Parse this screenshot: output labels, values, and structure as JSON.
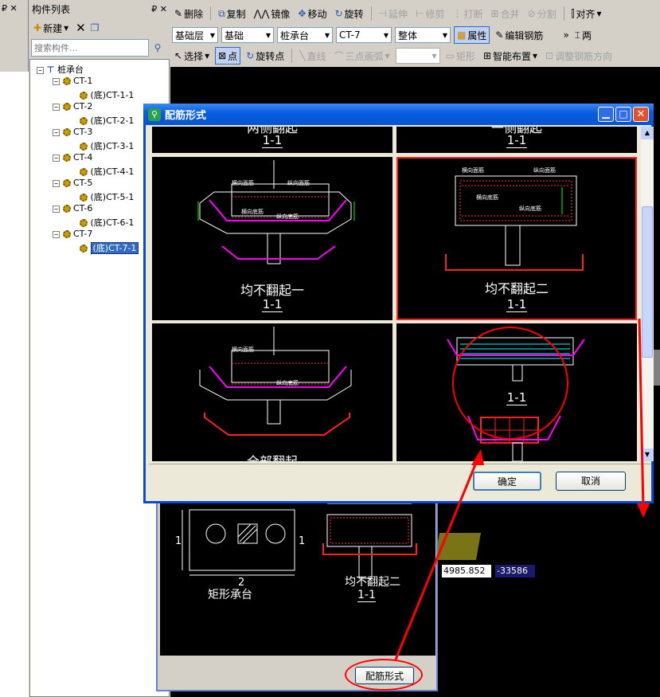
{
  "left_panel": {
    "pin_label": "₽",
    "title": "构件列表",
    "new_button": "新建",
    "search_placeholder": "搜索构件...",
    "tree_root": "桩承台",
    "tree": [
      {
        "name": "CT-1",
        "child": "(底)CT-1-1"
      },
      {
        "name": "CT-2",
        "child": "(底)CT-2-1"
      },
      {
        "name": "CT-3",
        "child": "(底)CT-3-1"
      },
      {
        "name": "CT-4",
        "child": "(底)CT-4-1"
      },
      {
        "name": "CT-5",
        "child": "(底)CT-5-1"
      },
      {
        "name": "CT-6",
        "child": "(底)CT-6-1"
      },
      {
        "name": "CT-7",
        "child": "(底)CT-7-1"
      }
    ]
  },
  "toolbar1": {
    "delete": "删除",
    "copy": "复制",
    "mirror": "镜像",
    "move": "移动",
    "rotate": "旋转",
    "extend": "延伸",
    "trim": "修剪",
    "break": "打断",
    "merge": "合并",
    "split": "分割",
    "align": "对齐"
  },
  "toolbar2": {
    "floor": "基础层",
    "category": "基础",
    "type": "桩承台",
    "component": "CT-7",
    "whole": "整体",
    "properties": "属性",
    "edit_rebar": "编辑钢筋",
    "two_point": "两"
  },
  "toolbar3": {
    "select": "选择",
    "point": "点",
    "rotate_point": "旋转点",
    "line": "直线",
    "arc": "三点画弧",
    "rect": "矩形",
    "smart": "智能布置",
    "adjust": "调整钢筋方向"
  },
  "dialog": {
    "title": "配筋形式",
    "confirm": "确定",
    "cancel": "取消",
    "cells": [
      {
        "caption": "两侧翻起",
        "section": "1-1"
      },
      {
        "caption": "一侧翻起",
        "section": "1-1"
      },
      {
        "caption": "均不翻起一",
        "section": "1-1"
      },
      {
        "caption": "均不翻起二",
        "section": "1-1"
      },
      {
        "caption": "全部翻起",
        "section": ""
      },
      {
        "caption": "",
        "section": "1-1"
      }
    ],
    "labels": {
      "top_rebar": "横向面筋",
      "long_top": "纵向面筋",
      "bottom_rebar": "横向底筋",
      "long_bottom": "纵向底筋"
    }
  },
  "lower_panel": {
    "caption_left": "矩形承台",
    "caption_right": "均不翻起二",
    "section": "1-1",
    "dim_num": "2",
    "side_num": "1",
    "button": "配筋形式"
  },
  "coords": {
    "x": "4985.852",
    "y": "-33586"
  },
  "colors": {
    "dialog_title": "#0a5ee0",
    "highlight_red": "#ff0000",
    "cad_black": "#000000"
  }
}
